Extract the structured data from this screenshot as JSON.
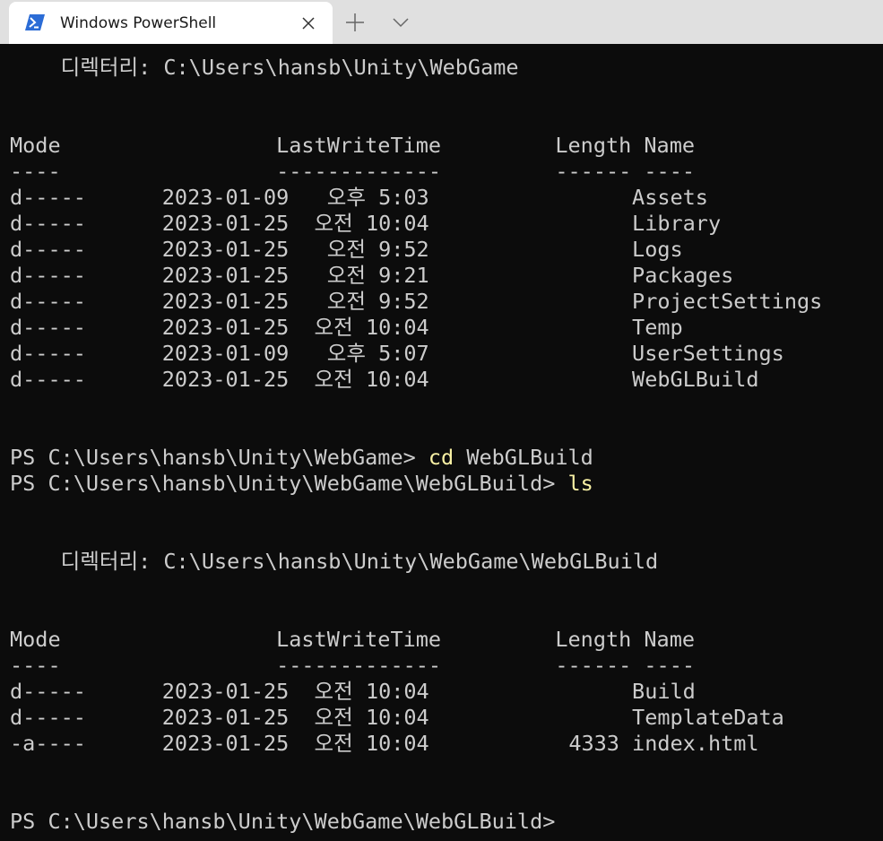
{
  "window": {
    "tab_title": "Windows PowerShell",
    "icons": {
      "tab": "powershell-icon",
      "close": "close-icon",
      "new_tab": "plus-icon",
      "dropdown": "chevron-down-icon"
    }
  },
  "colors": {
    "background": "#0c0c0c",
    "text": "#cccccc",
    "command": "#f9f1a5",
    "tabbar": "#e0e0e0",
    "tab": "#ffffff"
  },
  "terminal": {
    "lines": [
      {
        "text": "    디렉터리: C:\\Users\\hansb\\Unity\\WebGame"
      },
      {
        "text": ""
      },
      {
        "text": ""
      },
      {
        "text": "Mode                 LastWriteTime         Length Name"
      },
      {
        "text": "----                 -------------         ------ ----"
      },
      {
        "text": "d-----      2023-01-09   오후 5:03                Assets"
      },
      {
        "text": "d-----      2023-01-25  오전 10:04                Library"
      },
      {
        "text": "d-----      2023-01-25   오전 9:52                Logs"
      },
      {
        "text": "d-----      2023-01-25   오전 9:21                Packages"
      },
      {
        "text": "d-----      2023-01-25   오전 9:52                ProjectSettings"
      },
      {
        "text": "d-----      2023-01-25  오전 10:04                Temp"
      },
      {
        "text": "d-----      2023-01-09   오후 5:07                UserSettings"
      },
      {
        "text": "d-----      2023-01-25  오전 10:04                WebGLBuild"
      },
      {
        "text": ""
      },
      {
        "text": ""
      },
      {
        "prompt": "PS C:\\Users\\hansb\\Unity\\WebGame> ",
        "command": "cd",
        "args": " WebGLBuild"
      },
      {
        "prompt": "PS C:\\Users\\hansb\\Unity\\WebGame\\WebGLBuild> ",
        "command": "ls",
        "args": ""
      },
      {
        "text": ""
      },
      {
        "text": ""
      },
      {
        "text": "    디렉터리: C:\\Users\\hansb\\Unity\\WebGame\\WebGLBuild"
      },
      {
        "text": ""
      },
      {
        "text": ""
      },
      {
        "text": "Mode                 LastWriteTime         Length Name"
      },
      {
        "text": "----                 -------------         ------ ----"
      },
      {
        "text": "d-----      2023-01-25  오전 10:04                Build"
      },
      {
        "text": "d-----      2023-01-25  오전 10:04                TemplateData"
      },
      {
        "text": "-a----      2023-01-25  오전 10:04           4333 index.html"
      },
      {
        "text": ""
      },
      {
        "text": ""
      },
      {
        "prompt": "PS C:\\Users\\hansb\\Unity\\WebGame\\WebGLBuild> ",
        "command": "",
        "args": ""
      }
    ]
  }
}
